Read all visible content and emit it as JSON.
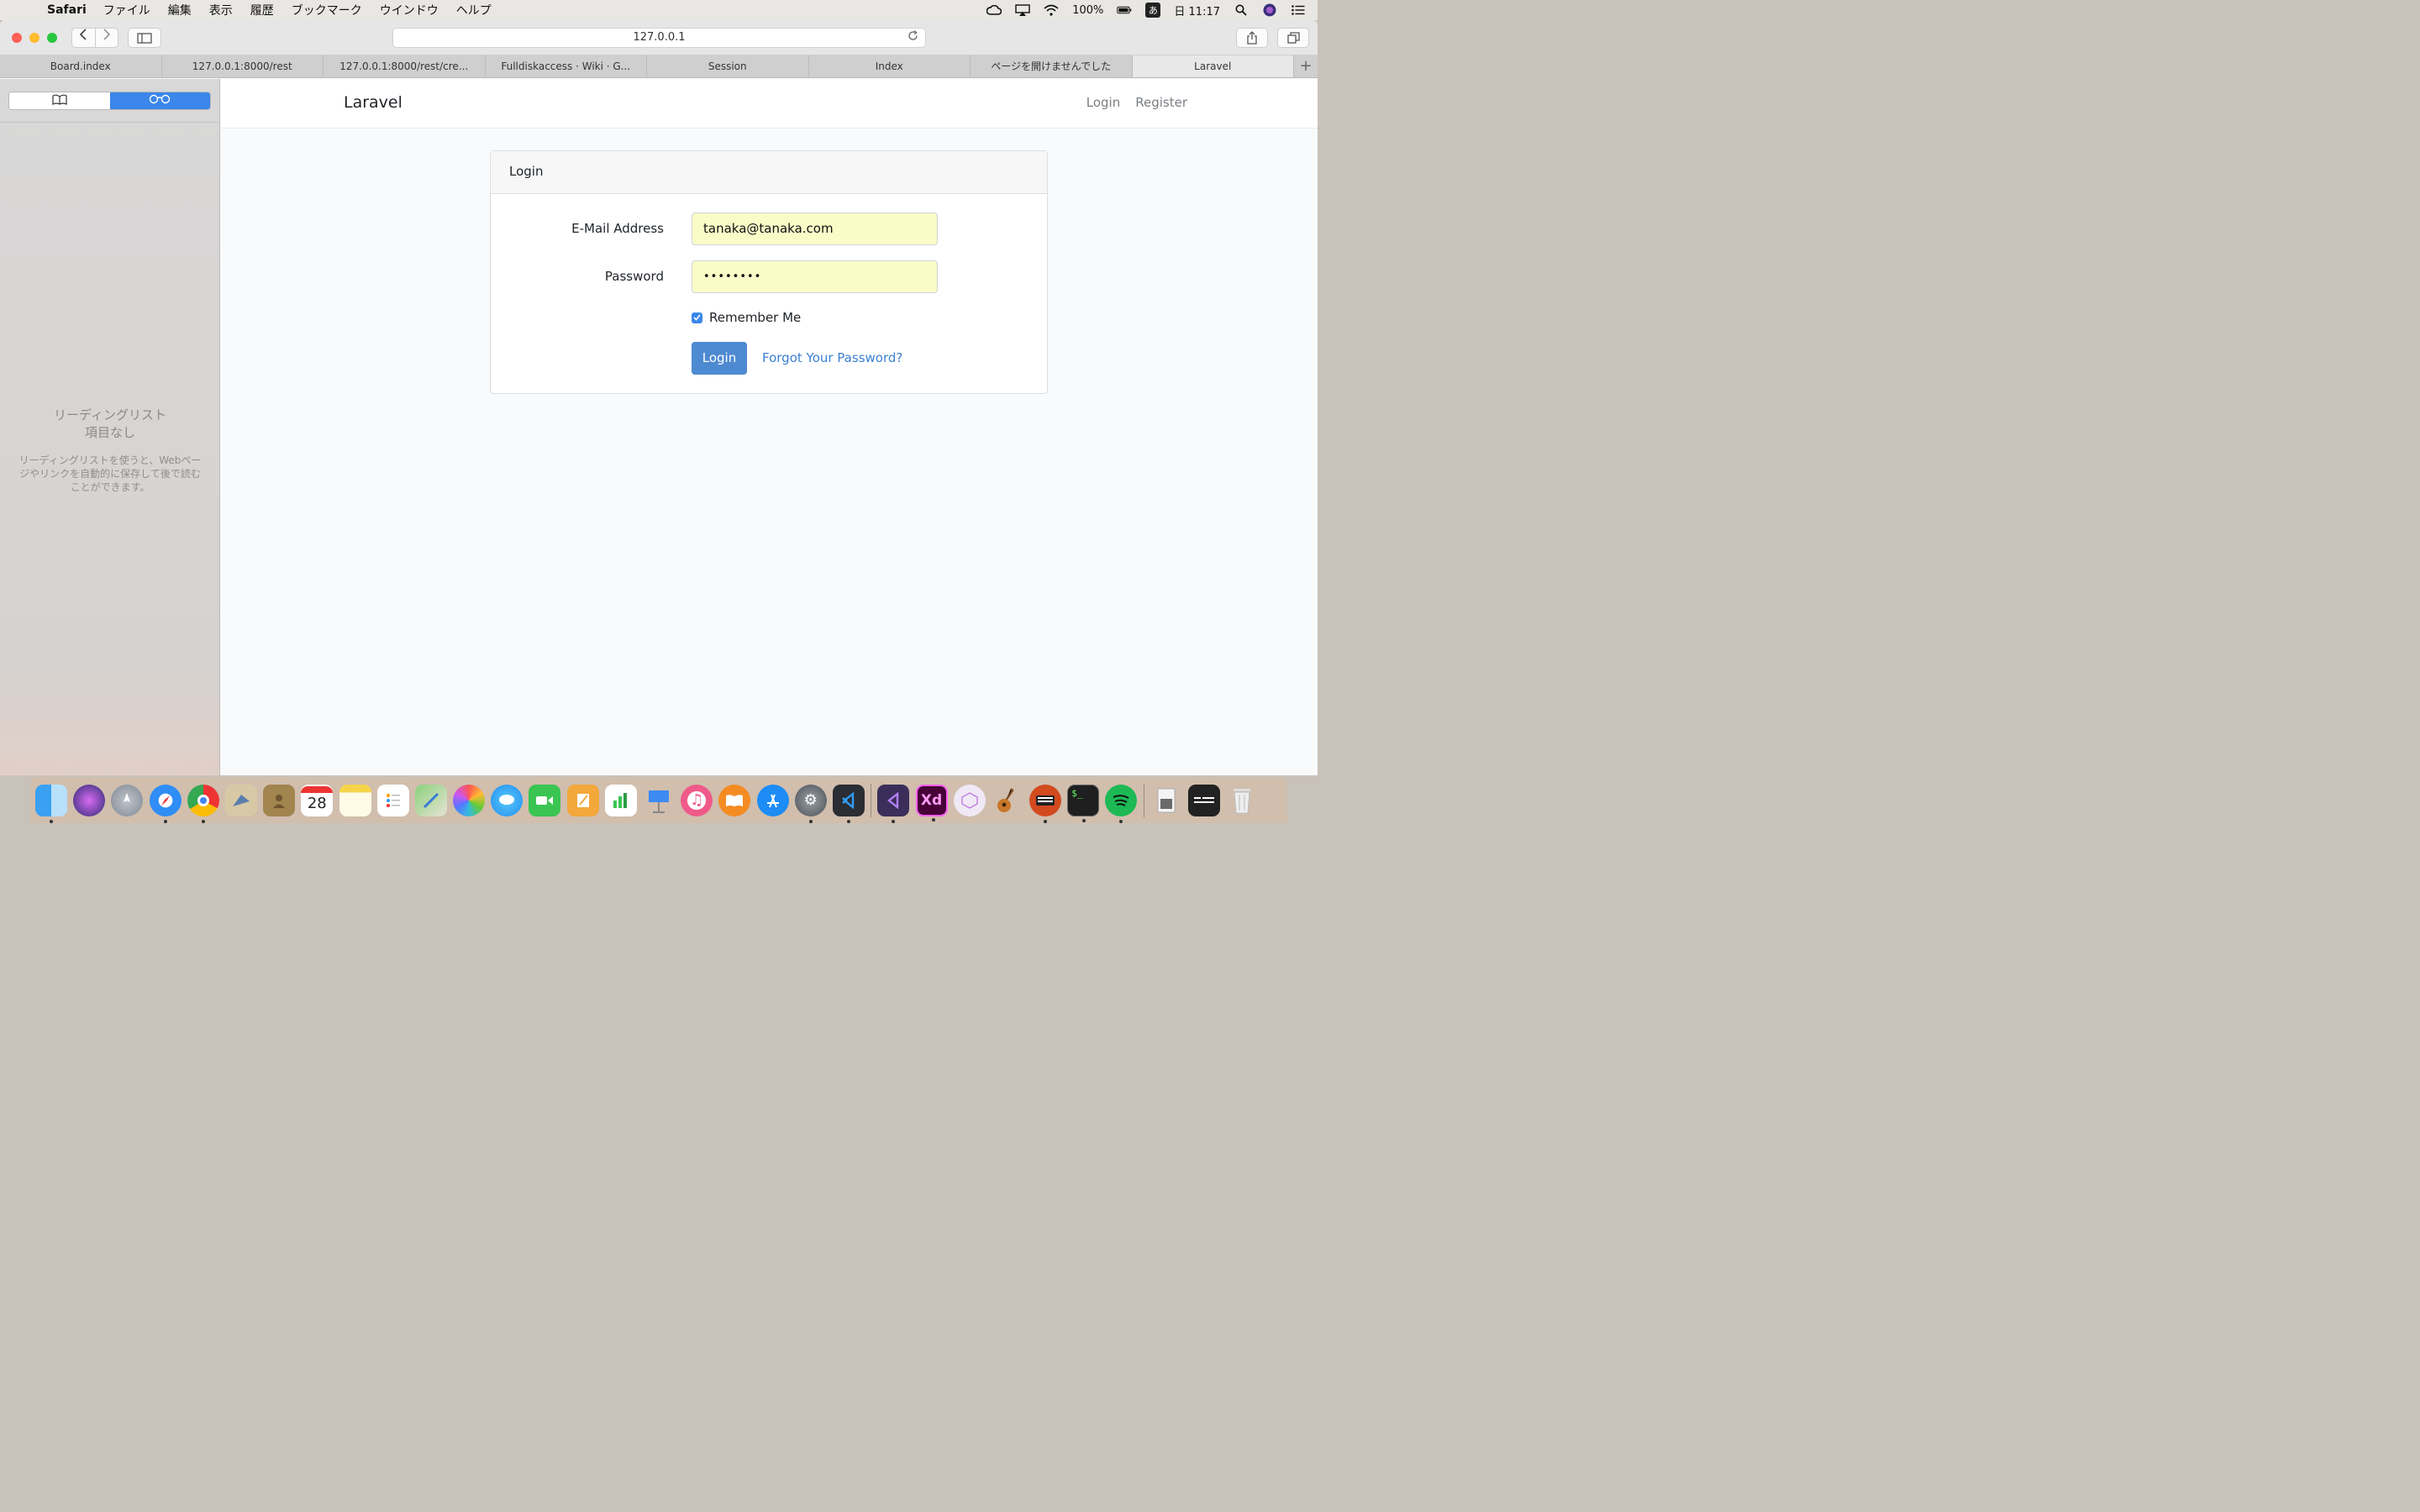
{
  "menubar": {
    "app": "Safari",
    "items": [
      "ファイル",
      "編集",
      "表示",
      "履歴",
      "ブックマーク",
      "ウインドウ",
      "ヘルプ"
    ],
    "battery": "100%",
    "ime": "あ",
    "clock": "日 11:17"
  },
  "browser": {
    "url": "127.0.0.1",
    "tabs": [
      {
        "label": "Board.index"
      },
      {
        "label": "127.0.0.1:8000/rest"
      },
      {
        "label": "127.0.0.1:8000/rest/cre..."
      },
      {
        "label": "Fulldiskaccess · Wiki · G..."
      },
      {
        "label": "Session"
      },
      {
        "label": "Index"
      },
      {
        "label": "ページを開けませんでした"
      },
      {
        "label": "Laravel"
      }
    ],
    "active_tab": 7
  },
  "sidebar": {
    "empty_title_line1": "リーディングリスト",
    "empty_title_line2": "項目なし",
    "empty_desc": "リーディングリストを使うと、Webページやリンクを自動的に保存して後で読むことができます。"
  },
  "page": {
    "brand": "Laravel",
    "nav": {
      "login": "Login",
      "register": "Register"
    },
    "card_title": "Login",
    "email_label": "E-Mail Address",
    "email_value": "tanaka@tanaka.com",
    "password_label": "Password",
    "password_value": "••••••••",
    "remember_label": "Remember Me",
    "remember_checked": true,
    "login_button": "Login",
    "forgot_link": "Forgot Your Password?"
  },
  "dock": {
    "apps": [
      "finder",
      "siri",
      "launchpad",
      "safari",
      "chrome",
      "mail",
      "contacts",
      "calendar",
      "notes",
      "reminders",
      "maps",
      "photos",
      "messages",
      "facetime",
      "pages",
      "numbers",
      "keynote",
      "music",
      "books",
      "app-store",
      "system-preferences",
      "vscode",
      "visual-studio",
      "adobe-xd",
      "ar-app",
      "garageband",
      "keyboard-app",
      "terminal",
      "spotify",
      "downloads",
      "screen-app",
      "trash"
    ],
    "calendar_day": "28",
    "xd_label": "Xd"
  },
  "colors": {
    "accent": "#3b86ea",
    "login_button": "#4e8ad1",
    "autofill": "#fafcc8",
    "link": "#3b7fd0"
  }
}
